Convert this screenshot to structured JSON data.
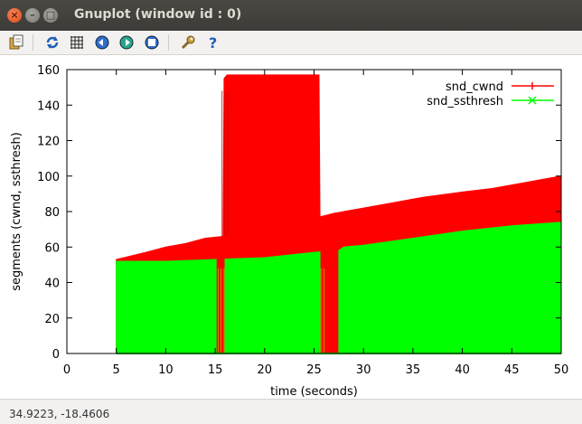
{
  "window": {
    "title": "Gnuplot (window id : 0)"
  },
  "titlebar_buttons": {
    "close": "×",
    "minimize": "–",
    "maximize": "□"
  },
  "toolbar": {
    "icons": [
      "copy-to-clipboard-icon",
      "replot-icon",
      "grid-icon",
      "zoom-prev-icon",
      "zoom-next-icon",
      "autoscale-icon",
      "settings-icon",
      "help-icon"
    ]
  },
  "status": {
    "coords": "34.9223, -18.4606"
  },
  "colors": {
    "cwnd": "#ff0000",
    "ssthresh": "#00ff00",
    "axis": "#000000"
  },
  "chart_data": {
    "type": "area",
    "title": "",
    "xlabel": "time (seconds)",
    "ylabel": "segments (cwnd, ssthresh)",
    "xlim": [
      0,
      50
    ],
    "ylim": [
      0,
      160
    ],
    "xticks": [
      0,
      5,
      10,
      15,
      20,
      25,
      30,
      35,
      40,
      45,
      50
    ],
    "yticks": [
      0,
      20,
      40,
      60,
      80,
      100,
      120,
      140,
      160
    ],
    "legend_position": "top-right",
    "series": [
      {
        "name": "snd_cwnd",
        "color": "#ff0000",
        "x": [
          5,
          8,
          10,
          12,
          14,
          15.8,
          15.9,
          16.2,
          19,
          22,
          25.5,
          25.6,
          27,
          30,
          33,
          36,
          40,
          43,
          46,
          48,
          50
        ],
        "y": [
          53,
          57,
          60,
          62,
          65,
          66,
          155,
          157,
          157,
          157,
          157,
          77,
          79,
          82,
          85,
          88,
          91,
          93,
          96,
          98,
          100
        ]
      },
      {
        "name": "snd_ssthresh",
        "color": "#00ff00",
        "x": [
          5,
          10,
          15,
          20,
          25,
          27.5,
          28,
          30,
          35,
          40,
          45,
          50
        ],
        "y": [
          52,
          52,
          53,
          54,
          57,
          58,
          60,
          61,
          65,
          69,
          72,
          74
        ]
      }
    ]
  }
}
